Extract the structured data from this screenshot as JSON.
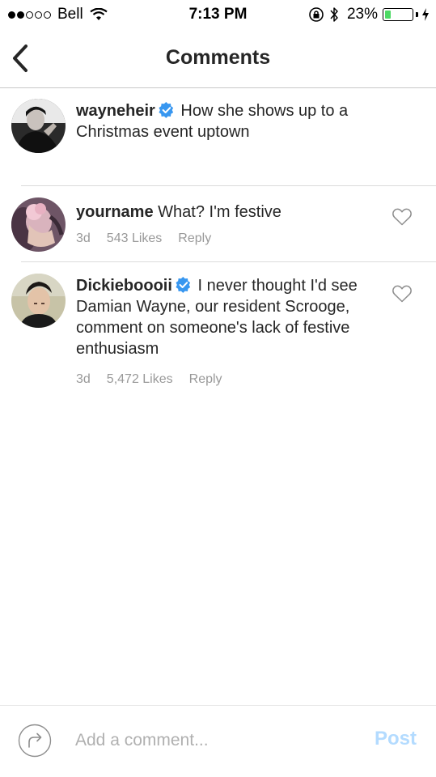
{
  "status_bar": {
    "carrier": "Bell",
    "time": "7:13 PM",
    "battery_percent": "23%",
    "battery_level": 0.23,
    "signal_bars_filled": 2,
    "signal_bars_total": 5
  },
  "header": {
    "title": "Comments"
  },
  "caption": {
    "username": "wayneheir",
    "verified": true,
    "text": "How she shows up to a Christmas event uptown"
  },
  "comments": [
    {
      "username": "yourname",
      "verified": false,
      "text": "What? I'm festive",
      "age": "3d",
      "likes": "543 Likes",
      "reply_label": "Reply"
    },
    {
      "username": "Dickieboooii",
      "verified": true,
      "text": "I never thought I'd see Damian Wayne, our resident Scrooge, comment on someone's lack of festive enthusiasm",
      "age": "3d",
      "likes": "5,472 Likes",
      "reply_label": "Reply"
    }
  ],
  "composer": {
    "placeholder": "Add a comment...",
    "post_label": "Post"
  },
  "colors": {
    "verified": "#3897f0",
    "post_disabled": "#b3dbff",
    "meta_text": "#999999",
    "battery_fill": "#4cd964"
  }
}
